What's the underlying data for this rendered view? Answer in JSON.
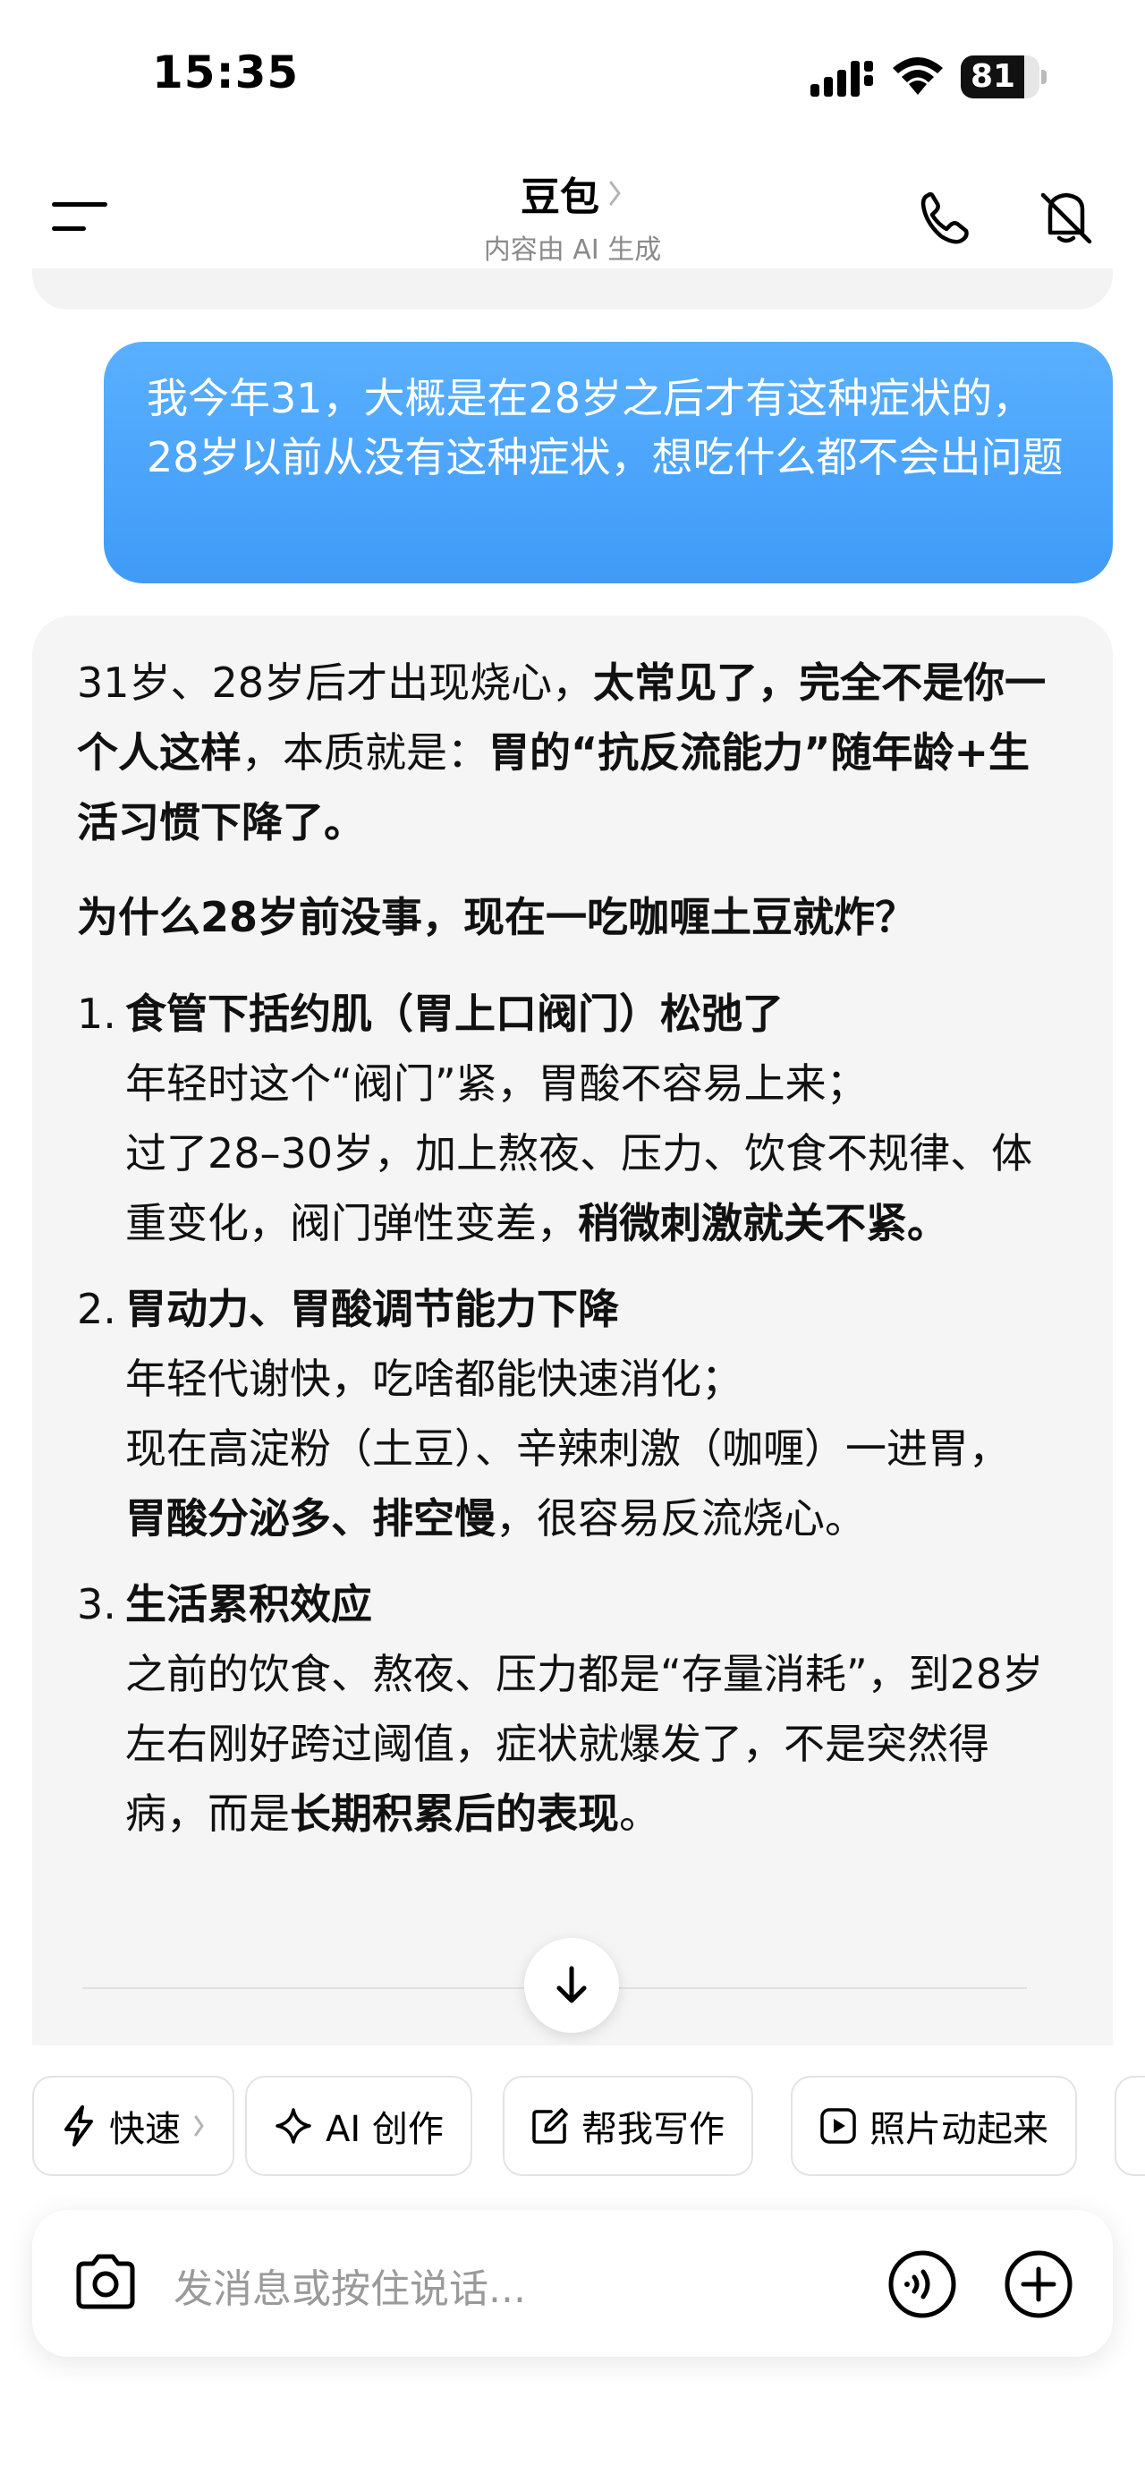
{
  "status_bar": {
    "time": "15:35",
    "battery": "81",
    "battery_level": 0.81
  },
  "header": {
    "title": "豆包",
    "subtitle": "内容由 AI 生成"
  },
  "user_message": "我今年31，大概是在28岁之后才有这种症状的，28岁以前从没有这种症状，想吃什么都不会出问题",
  "ai_message": {
    "intro_plain": "31岁、28岁后才出现烧心，",
    "intro_bold1": "太常见了，完全不是你一个人这样",
    "intro_mid": "，本质就是：",
    "intro_bold2": "胃的“抗反流能力”随年龄+生活习惯下降了。",
    "question": "为什么28岁前没事，现在一吃咖喱土豆就炸？",
    "items": [
      {
        "num": "1.",
        "title": "食管下括约肌（胃上口阀门）松弛了",
        "line1": "年轻时这个“阀门”紧，胃酸不容易上来；",
        "line2_plain": "过了28–30岁，加上熬夜、压力、饮食不规律、体重变化，阀门弹性变差，",
        "line2_bold": "稍微刺激就关不紧。"
      },
      {
        "num": "2.",
        "title": "胃动力、胃酸调节能力下降",
        "line1": "年轻代谢快，吃啥都能快速消化；",
        "line2_plain": "现在高淀粉（土豆）、辛辣刺激（咖喱）一进胃，",
        "line3_bold": "胃酸分泌多、排空慢",
        "line3_plain": "，很容易反流烧心。"
      },
      {
        "num": "3.",
        "title": "生活累积效应",
        "line1_plain": "之前的饮食、熬夜、压力都是“存量消耗”，到28岁左右刚好跨过阈值，症状就爆发了，不是突然得病，而是",
        "line1_bold": "长期积累后的表现",
        "line1_end": "。"
      }
    ]
  },
  "quick_actions": [
    {
      "label": "快速",
      "icon": "lightning-icon"
    },
    {
      "label": "AI 创作",
      "icon": "sparkle-icon"
    },
    {
      "label": "帮我写作",
      "icon": "edit-icon"
    },
    {
      "label": "照片动起来",
      "icon": "play-icon"
    }
  ],
  "input": {
    "placeholder": "发消息或按住说话..."
  },
  "colors": {
    "user_bubble": "#4aa5fb",
    "card_bg": "#f5f5f5",
    "subtitle": "#8a8a8a"
  }
}
